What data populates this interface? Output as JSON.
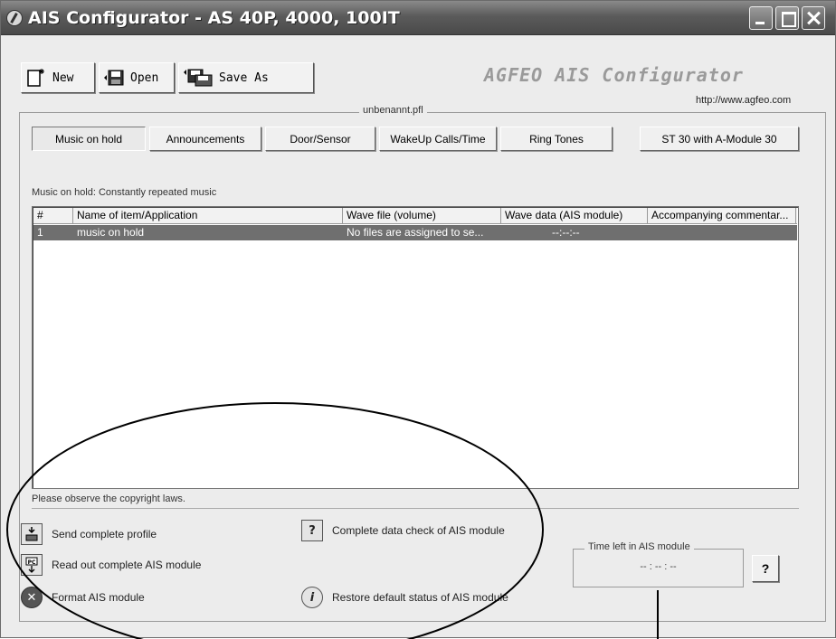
{
  "window": {
    "title": "AIS Configurator - AS 40P, 4000, 100IT"
  },
  "toolbar": {
    "new_label": "New",
    "open_label": "Open",
    "save_as_label": "Save As"
  },
  "brand": {
    "name": "AGFEO AIS Configurator",
    "url": "http://www.agfeo.com"
  },
  "file": {
    "name": "unbenannt.pfl"
  },
  "tabs": [
    {
      "label": "Music on hold",
      "active": true
    },
    {
      "label": "Announcements",
      "active": false
    },
    {
      "label": "Door/Sensor",
      "active": false
    },
    {
      "label": "WakeUp Calls/Time",
      "active": false
    },
    {
      "label": "Ring Tones",
      "active": false
    },
    {
      "label": "ST 30 with A-Module 30",
      "active": false
    }
  ],
  "list": {
    "caption": "Music on hold: Constantly repeated music",
    "columns": [
      "#",
      "Name of item/Application",
      "Wave file (volume)",
      "Wave data (AIS module)",
      "Accompanying commentar..."
    ],
    "rows": [
      {
        "num": "1",
        "name": "music on hold",
        "wave_file": "No files are assigned to se...",
        "wave_data": "--:--:--",
        "comment": ""
      }
    ]
  },
  "footer": {
    "copyright": "Please observe the copyright laws."
  },
  "actions": {
    "send_profile": "Send complete profile",
    "read_out": "Read out complete AIS module",
    "format": "Format AIS module",
    "data_check": "Complete data check of AIS module",
    "restore_default": "Restore default status of AIS module"
  },
  "time_left": {
    "label": "Time left in AIS module",
    "value": "-- : -- : --"
  },
  "colors": {
    "selection": "#6f6f6f",
    "window_bg": "#ececec"
  }
}
